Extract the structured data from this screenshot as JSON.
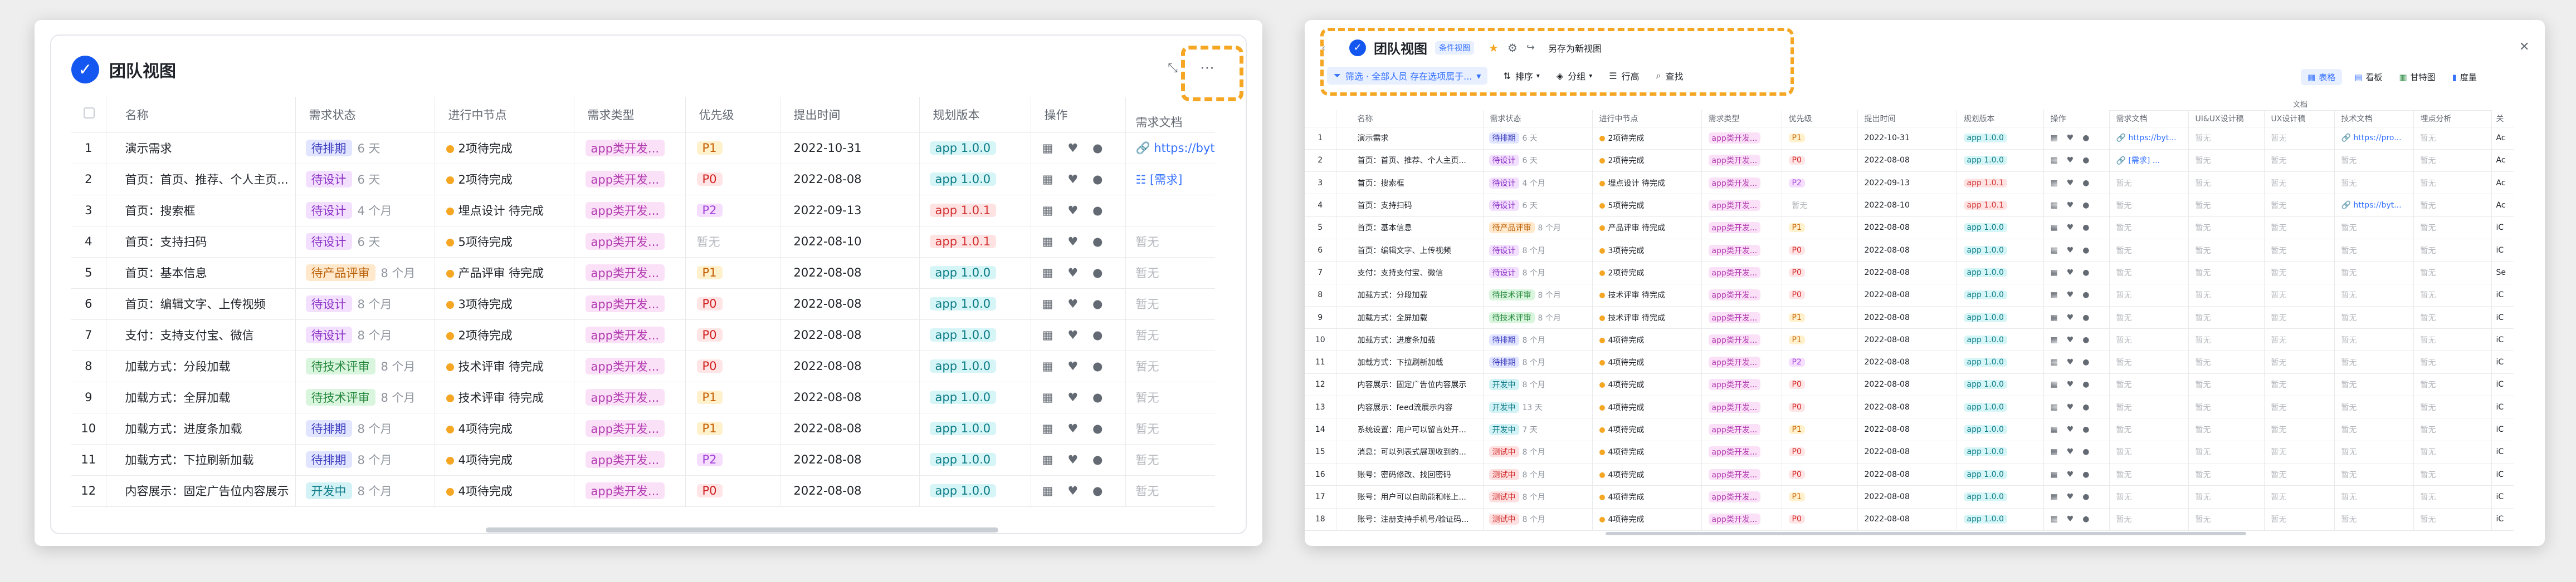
{
  "left": {
    "title": "团队视图",
    "expand_icon": "expand-icon",
    "more_icon": "more-icon",
    "headers": [
      "名称",
      "需求状态",
      "进行中节点",
      "需求类型",
      "优先级",
      "提出时间",
      "规划版本",
      "操作",
      "需求文档"
    ],
    "rows": [
      {
        "num": "1",
        "name": "演示需求",
        "status": "待排期",
        "st": "paiqi",
        "ago": "6 天",
        "node": "2项待完成",
        "type": "app类开发...",
        "pri": "P1",
        "date": "2022-10-31",
        "ver": "app 1.0.0",
        "vc": "ver",
        "doc": "https://byt"
      },
      {
        "num": "2",
        "name": "首页：首页、推荐、个人主页...",
        "status": "待设计",
        "st": "sheji",
        "ago": "6 天",
        "node": "2项待完成",
        "type": "app类开发...",
        "pri": "P0",
        "date": "2022-08-08",
        "ver": "app 1.0.0",
        "vc": "ver",
        "doc": "[需求]"
      },
      {
        "num": "3",
        "name": "首页：搜索框",
        "status": "待设计",
        "st": "sheji",
        "ago": "4 个月",
        "node": "埋点设计 待完成",
        "type": "app类开发...",
        "pri": "P2",
        "date": "2022-09-13",
        "ver": "app 1.0.1",
        "vc": "ver2",
        "doc": ""
      },
      {
        "num": "4",
        "name": "首页：支持扫码",
        "status": "待设计",
        "st": "sheji",
        "ago": "6 天",
        "node": "5项待完成",
        "type": "app类开发...",
        "pri": "暂无",
        "date": "2022-08-10",
        "ver": "app 1.0.1",
        "vc": "ver2",
        "doc": "暂无"
      },
      {
        "num": "5",
        "name": "首页：基本信息",
        "status": "待产品评审",
        "st": "chanpin",
        "ago": "8 个月",
        "node": "产品评审 待完成",
        "type": "app类开发...",
        "pri": "P1",
        "date": "2022-08-08",
        "ver": "app 1.0.0",
        "vc": "ver",
        "doc": "暂无"
      },
      {
        "num": "6",
        "name": "首页：编辑文字、上传视频",
        "status": "待设计",
        "st": "sheji",
        "ago": "8 个月",
        "node": "3项待完成",
        "type": "app类开发...",
        "pri": "P0",
        "date": "2022-08-08",
        "ver": "app 1.0.0",
        "vc": "ver",
        "doc": "暂无"
      },
      {
        "num": "7",
        "name": "支付：支持支付宝、微信",
        "status": "待设计",
        "st": "sheji",
        "ago": "8 个月",
        "node": "2项待完成",
        "type": "app类开发...",
        "pri": "P0",
        "date": "2022-08-08",
        "ver": "app 1.0.0",
        "vc": "ver",
        "doc": "暂无"
      },
      {
        "num": "8",
        "name": "加载方式：分段加载",
        "status": "待技术评审",
        "st": "jishu",
        "ago": "8 个月",
        "node": "技术评审 待完成",
        "type": "app类开发...",
        "pri": "P0",
        "date": "2022-08-08",
        "ver": "app 1.0.0",
        "vc": "ver",
        "doc": "暂无"
      },
      {
        "num": "9",
        "name": "加载方式：全屏加载",
        "status": "待技术评审",
        "st": "jishu",
        "ago": "8 个月",
        "node": "技术评审 待完成",
        "type": "app类开发...",
        "pri": "P1",
        "date": "2022-08-08",
        "ver": "app 1.0.0",
        "vc": "ver",
        "doc": "暂无"
      },
      {
        "num": "10",
        "name": "加载方式：进度条加载",
        "status": "待排期",
        "st": "paiqi",
        "ago": "8 个月",
        "node": "4项待完成",
        "type": "app类开发...",
        "pri": "P1",
        "date": "2022-08-08",
        "ver": "app 1.0.0",
        "vc": "ver",
        "doc": "暂无"
      },
      {
        "num": "11",
        "name": "加载方式：下拉刷新加载",
        "status": "待排期",
        "st": "paiqi",
        "ago": "8 个月",
        "node": "4项待完成",
        "type": "app类开发...",
        "pri": "P2",
        "date": "2022-08-08",
        "ver": "app 1.0.0",
        "vc": "ver",
        "doc": "暂无"
      },
      {
        "num": "12",
        "name": "内容展示：固定广告位内容展示",
        "status": "开发中",
        "st": "kaifa",
        "ago": "8 个月",
        "node": "4项待完成",
        "type": "app类开发...",
        "pri": "P0",
        "date": "2022-08-08",
        "ver": "app 1.0.0",
        "vc": "ver",
        "doc": "暂无"
      }
    ]
  },
  "right": {
    "title": "团队视图",
    "badge": "条件视图",
    "save_as": "另存为新视图",
    "filter": "筛选 · 全部人员 存在选项属于...",
    "sort": "排序",
    "group": "分组",
    "row_height": "行高",
    "find": "查找",
    "views": [
      "表格",
      "看板",
      "甘特图",
      "度量"
    ],
    "doc_group": "文档",
    "headers": [
      "名称",
      "需求状态",
      "进行中节点",
      "需求类型",
      "优先级",
      "提出时间",
      "规划版本",
      "操作",
      "需求文档",
      "UI&UX设计稿",
      "UX设计稿",
      "技术文档",
      "埋点分析",
      "关"
    ],
    "rows": [
      {
        "num": "1",
        "name": "演示需求",
        "status": "待排期",
        "st": "paiqi",
        "ago": "6 天",
        "node": "2项待完成",
        "type": "app类开发...",
        "pri": "P1",
        "date": "2022-10-31",
        "ver": "app 1.0.0",
        "vc": "ver",
        "d1": "https://byt...",
        "d2": "暂无",
        "d3": "暂无",
        "d4": "https://pro...",
        "d5": "暂无",
        "d6": "Ac"
      },
      {
        "num": "2",
        "name": "首页：首页、推荐、个人主页...",
        "status": "待设计",
        "st": "sheji",
        "ago": "6 天",
        "node": "2项待完成",
        "type": "app类开发...",
        "pri": "P0",
        "date": "2022-08-08",
        "ver": "app 1.0.0",
        "vc": "ver",
        "d1": "[需求] ...",
        "d2": "暂无",
        "d3": "暂无",
        "d4": "暂无",
        "d5": "暂无",
        "d6": "Ac"
      },
      {
        "num": "3",
        "name": "首页：搜索框",
        "status": "待设计",
        "st": "sheji",
        "ago": "4 个月",
        "node": "埋点设计 待完成",
        "type": "app类开发...",
        "pri": "P2",
        "date": "2022-09-13",
        "ver": "app 1.0.1",
        "vc": "ver2",
        "d1": "暂无",
        "d2": "暂无",
        "d3": "暂无",
        "d4": "暂无",
        "d5": "暂无",
        "d6": "Ac"
      },
      {
        "num": "4",
        "name": "首页：支持扫码",
        "status": "待设计",
        "st": "sheji",
        "ago": "6 天",
        "node": "5项待完成",
        "type": "app类开发...",
        "pri": "暂无",
        "date": "2022-08-10",
        "ver": "app 1.0.1",
        "vc": "ver2",
        "d1": "暂无",
        "d2": "暂无",
        "d3": "暂无",
        "d4": "https://byt...",
        "d5": "暂无",
        "d6": "Ac"
      },
      {
        "num": "5",
        "name": "首页：基本信息",
        "status": "待产品评审",
        "st": "chanpin",
        "ago": "8 个月",
        "node": "产品评审 待完成",
        "type": "app类开发...",
        "pri": "P1",
        "date": "2022-08-08",
        "ver": "app 1.0.0",
        "vc": "ver",
        "d1": "暂无",
        "d2": "暂无",
        "d3": "暂无",
        "d4": "暂无",
        "d5": "暂无",
        "d6": "iC"
      },
      {
        "num": "6",
        "name": "首页：编辑文字、上传视频",
        "status": "待设计",
        "st": "sheji",
        "ago": "8 个月",
        "node": "3项待完成",
        "type": "app类开发...",
        "pri": "P0",
        "date": "2022-08-08",
        "ver": "app 1.0.0",
        "vc": "ver",
        "d1": "暂无",
        "d2": "暂无",
        "d3": "暂无",
        "d4": "暂无",
        "d5": "暂无",
        "d6": "iC"
      },
      {
        "num": "7",
        "name": "支付：支持支付宝、微信",
        "status": "待设计",
        "st": "sheji",
        "ago": "8 个月",
        "node": "2项待完成",
        "type": "app类开发...",
        "pri": "P0",
        "date": "2022-08-08",
        "ver": "app 1.0.0",
        "vc": "ver",
        "d1": "暂无",
        "d2": "暂无",
        "d3": "暂无",
        "d4": "暂无",
        "d5": "暂无",
        "d6": "Se"
      },
      {
        "num": "8",
        "name": "加载方式：分段加载",
        "status": "待技术评审",
        "st": "jishu",
        "ago": "8 个月",
        "node": "技术评审 待完成",
        "type": "app类开发...",
        "pri": "P0",
        "date": "2022-08-08",
        "ver": "app 1.0.0",
        "vc": "ver",
        "d1": "暂无",
        "d2": "暂无",
        "d3": "暂无",
        "d4": "暂无",
        "d5": "暂无",
        "d6": "iC"
      },
      {
        "num": "9",
        "name": "加载方式：全屏加载",
        "status": "待技术评审",
        "st": "jishu",
        "ago": "8 个月",
        "node": "技术评审 待完成",
        "type": "app类开发...",
        "pri": "P1",
        "date": "2022-08-08",
        "ver": "app 1.0.0",
        "vc": "ver",
        "d1": "暂无",
        "d2": "暂无",
        "d3": "暂无",
        "d4": "暂无",
        "d5": "暂无",
        "d6": "iC"
      },
      {
        "num": "10",
        "name": "加载方式：进度条加载",
        "status": "待排期",
        "st": "paiqi",
        "ago": "8 个月",
        "node": "4项待完成",
        "type": "app类开发...",
        "pri": "P1",
        "date": "2022-08-08",
        "ver": "app 1.0.0",
        "vc": "ver",
        "d1": "暂无",
        "d2": "暂无",
        "d3": "暂无",
        "d4": "暂无",
        "d5": "暂无",
        "d6": "iC"
      },
      {
        "num": "11",
        "name": "加载方式：下拉刷新加载",
        "status": "待排期",
        "st": "paiqi",
        "ago": "8 个月",
        "node": "4项待完成",
        "type": "app类开发...",
        "pri": "P2",
        "date": "2022-08-08",
        "ver": "app 1.0.0",
        "vc": "ver",
        "d1": "暂无",
        "d2": "暂无",
        "d3": "暂无",
        "d4": "暂无",
        "d5": "暂无",
        "d6": "iC"
      },
      {
        "num": "12",
        "name": "内容展示：固定广告位内容展示",
        "status": "开发中",
        "st": "kaifa",
        "ago": "8 个月",
        "node": "4项待完成",
        "type": "app类开发...",
        "pri": "P0",
        "date": "2022-08-08",
        "ver": "app 1.0.0",
        "vc": "ver",
        "d1": "暂无",
        "d2": "暂无",
        "d3": "暂无",
        "d4": "暂无",
        "d5": "暂无",
        "d6": "iC"
      },
      {
        "num": "13",
        "name": "内容展示：feed流展示内容",
        "status": "开发中",
        "st": "kaifa",
        "ago": "13 天",
        "node": "4项待完成",
        "type": "app类开发...",
        "pri": "P0",
        "date": "2022-08-08",
        "ver": "app 1.0.0",
        "vc": "ver",
        "d1": "暂无",
        "d2": "暂无",
        "d3": "暂无",
        "d4": "暂无",
        "d5": "暂无",
        "d6": "iC"
      },
      {
        "num": "14",
        "name": "系统设置：用户可以留言处开...",
        "status": "开发中",
        "st": "kaifa",
        "ago": "7 天",
        "node": "4项待完成",
        "type": "app类开发...",
        "pri": "P1",
        "date": "2022-08-08",
        "ver": "app 1.0.0",
        "vc": "ver",
        "d1": "暂无",
        "d2": "暂无",
        "d3": "暂无",
        "d4": "暂无",
        "d5": "暂无",
        "d6": "iC"
      },
      {
        "num": "15",
        "name": "消息：可以列表式展现收到的...",
        "status": "测试中",
        "st": "ceshi",
        "ago": "8 个月",
        "node": "4项待完成",
        "type": "app类开发...",
        "pri": "P0",
        "date": "2022-08-08",
        "ver": "app 1.0.0",
        "vc": "ver",
        "d1": "暂无",
        "d2": "暂无",
        "d3": "暂无",
        "d4": "暂无",
        "d5": "暂无",
        "d6": "iC"
      },
      {
        "num": "16",
        "name": "账号：密码修改、找回密码",
        "status": "测试中",
        "st": "ceshi",
        "ago": "8 个月",
        "node": "4项待完成",
        "type": "app类开发...",
        "pri": "P0",
        "date": "2022-08-08",
        "ver": "app 1.0.0",
        "vc": "ver",
        "d1": "暂无",
        "d2": "暂无",
        "d3": "暂无",
        "d4": "暂无",
        "d5": "暂无",
        "d6": "iC"
      },
      {
        "num": "17",
        "name": "账号：用户可以自助能和帐上...",
        "status": "测试中",
        "st": "ceshi",
        "ago": "8 个月",
        "node": "4项待完成",
        "type": "app类开发...",
        "pri": "P1",
        "date": "2022-08-08",
        "ver": "app 1.0.0",
        "vc": "ver",
        "d1": "暂无",
        "d2": "暂无",
        "d3": "暂无",
        "d4": "暂无",
        "d5": "暂无",
        "d6": "iC"
      },
      {
        "num": "18",
        "name": "账号：注册支持手机号/验证码...",
        "status": "测试中",
        "st": "ceshi",
        "ago": "8 个月",
        "node": "4项待完成",
        "type": "app类开发...",
        "pri": "P0",
        "date": "2022-08-08",
        "ver": "app 1.0.0",
        "vc": "ver",
        "d1": "暂无",
        "d2": "暂无",
        "d3": "暂无",
        "d4": "暂无",
        "d5": "暂无",
        "d6": "iC"
      }
    ]
  },
  "colors": {
    "accent": "#1456f0",
    "highlight": "#f5a623",
    "link": "#3370ff"
  }
}
